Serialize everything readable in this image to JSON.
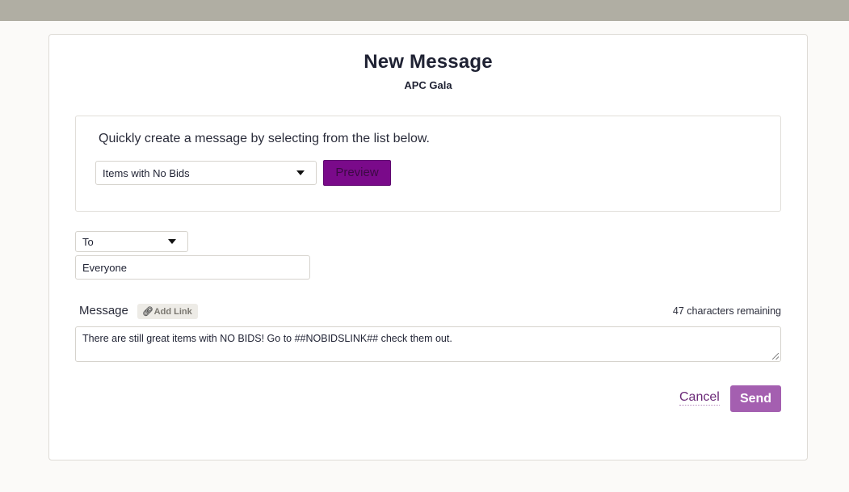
{
  "dialog": {
    "title": "New Message",
    "subtitle": "APC Gala"
  },
  "quick": {
    "instructions": "Quickly create a message by selecting from the list below.",
    "template_selected": "Items with No Bids",
    "preview_label": "Preview"
  },
  "recipients": {
    "to_selected": "To",
    "to_value": "Everyone"
  },
  "message": {
    "label": "Message",
    "add_link_label": "Add Link",
    "remaining": "47 characters remaining",
    "body": "There are still great items with NO BIDS! Go to ##NOBIDSLINK## check them out."
  },
  "actions": {
    "cancel_label": "Cancel",
    "send_label": "Send"
  },
  "colors": {
    "accent": "#7a0a8a",
    "send": "#a45fb0",
    "cancel_link": "#6b2a78",
    "topbar": "#b0aea3"
  },
  "icons": [
    "link-icon",
    "chevron-down-icon",
    "resize-handle-icon"
  ]
}
